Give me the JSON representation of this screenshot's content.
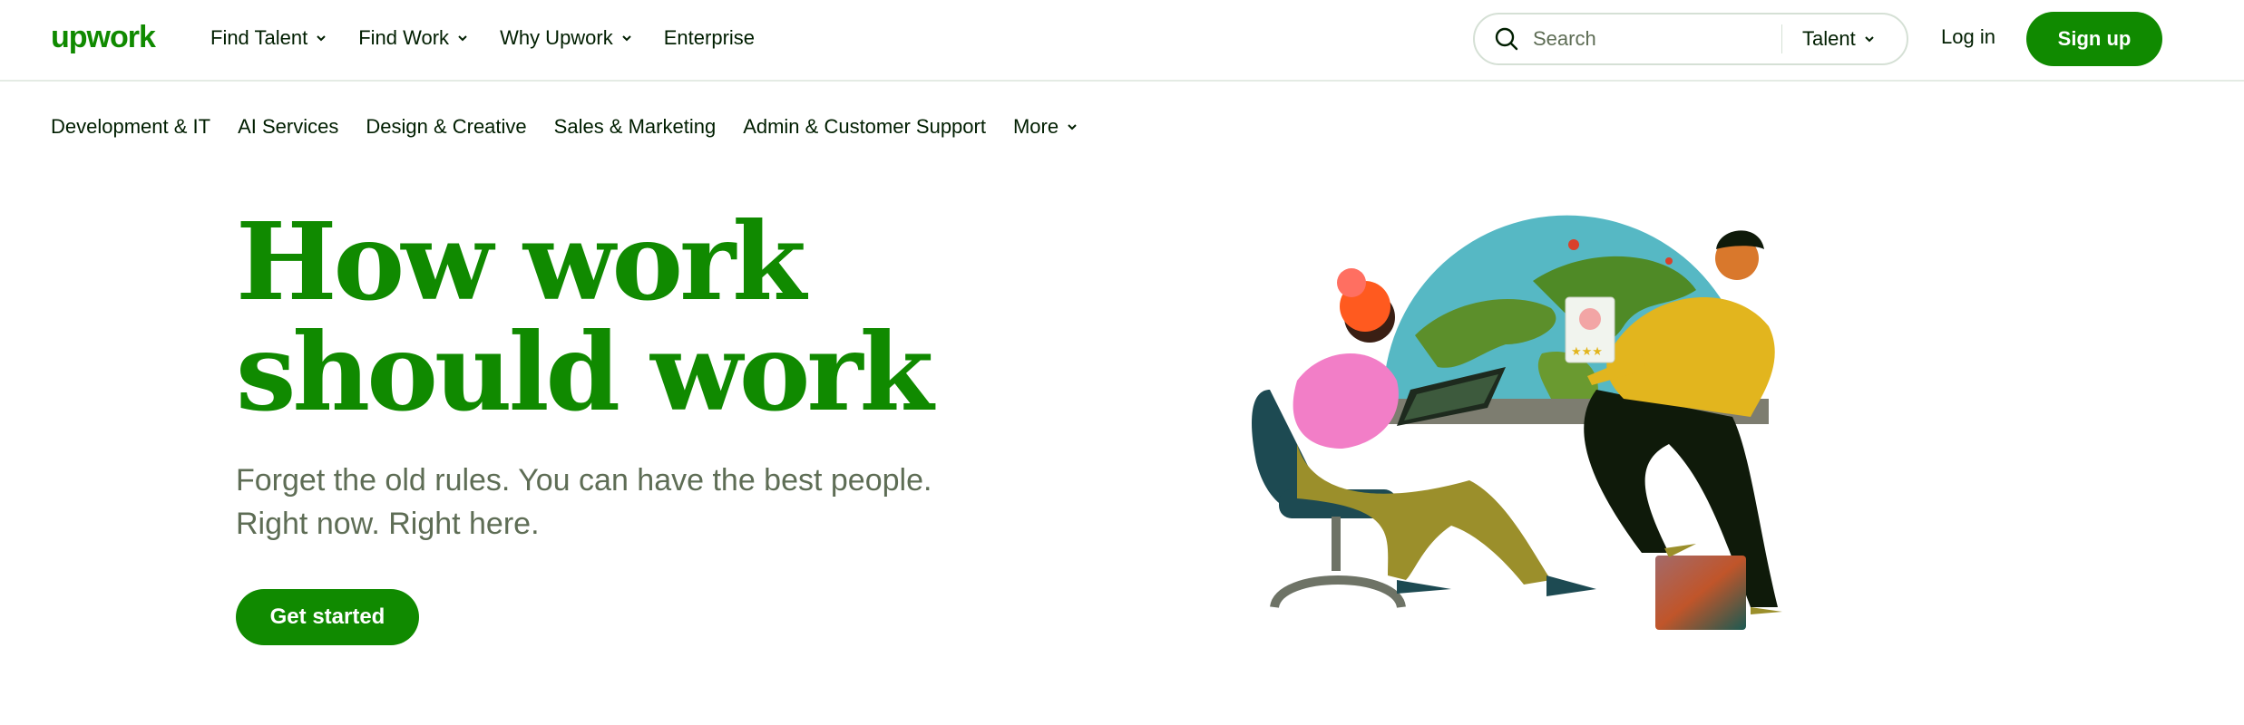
{
  "header": {
    "logo_text": "upwork",
    "nav": [
      {
        "label": "Find Talent",
        "has_dropdown": true
      },
      {
        "label": "Find Work",
        "has_dropdown": true
      },
      {
        "label": "Why Upwork",
        "has_dropdown": true
      },
      {
        "label": "Enterprise",
        "has_dropdown": false
      }
    ],
    "search": {
      "placeholder": "Search",
      "scope": "Talent"
    },
    "login_label": "Log in",
    "signup_label": "Sign up"
  },
  "categories": [
    {
      "label": "Development & IT"
    },
    {
      "label": "AI Services"
    },
    {
      "label": "Design & Creative"
    },
    {
      "label": "Sales & Marketing"
    },
    {
      "label": "Admin & Customer Support"
    },
    {
      "label": "More"
    }
  ],
  "hero": {
    "title_line1": "How work",
    "title_line2": "should work",
    "subtitle_line1": "Forget the old rules. You can have the best people.",
    "subtitle_line2": "Right now. Right here.",
    "cta_label": "Get started"
  },
  "colors": {
    "brand_green": "#108a00",
    "text_dark": "#001e00",
    "text_muted": "#5e6d55",
    "border": "#e4ebe4"
  }
}
